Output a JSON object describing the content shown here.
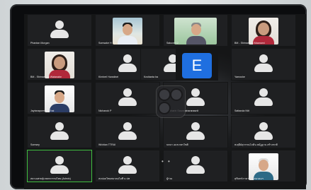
{
  "tiles": [
    {
      "name": "Phantan Morgan",
      "kind": "avatar"
    },
    {
      "name": "Somsake H",
      "kind": "video",
      "style": "office"
    },
    {
      "name": "Sakura K2",
      "kind": "video",
      "style": "green"
    },
    {
      "name": "BM - Shimamoto Maanami",
      "kind": "video",
      "style": "woman-red"
    },
    {
      "name": "BM - Shimamoto Watanabe",
      "kind": "video",
      "style": "woman-red"
    },
    {
      "name": "Kimberl Hanstinel",
      "kind": "avatar"
    },
    {
      "name": "Kovitanta Ira",
      "kind": "avatar"
    },
    {
      "name": "",
      "kind": "letter",
      "letter": "E"
    },
    {
      "name": "Yamoshe",
      "kind": "avatar"
    },
    {
      "name": "Jaytanaporn Lik Thai",
      "kind": "video",
      "style": "man-blue"
    },
    {
      "name": "Nichanok P",
      "kind": "avatar"
    },
    {
      "name": "Pattharin Sawanaharanasnit",
      "kind": "avatar"
    },
    {
      "name": "Sattanda Nitt",
      "kind": "avatar"
    },
    {
      "name": "Somsey",
      "kind": "avatar"
    },
    {
      "name": "Wichian TTRAI",
      "kind": "avatar"
    },
    {
      "name": "บษบา อมรเกษรโชติ",
      "kind": "avatar"
    },
    {
      "name": "พ.ศุนีย์สุวรรณโภคิน สมัฏฐาน สร้างชาติ",
      "kind": "avatar"
    },
    {
      "name": "สยามเศรษฐ์เกษตรกรรมไทย (Admin)",
      "kind": "avatar",
      "active": true
    },
    {
      "name": "สมปอลไทยสมาคมไอที ม.ปท",
      "kind": "avatar"
    },
    {
      "name": "ผู้ร่วม",
      "kind": "avatar"
    },
    {
      "name": "สุขินทร์ภาดาแสง สมาคมฯ",
      "kind": "video",
      "style": "man-white"
    }
  ],
  "pager": "• •"
}
